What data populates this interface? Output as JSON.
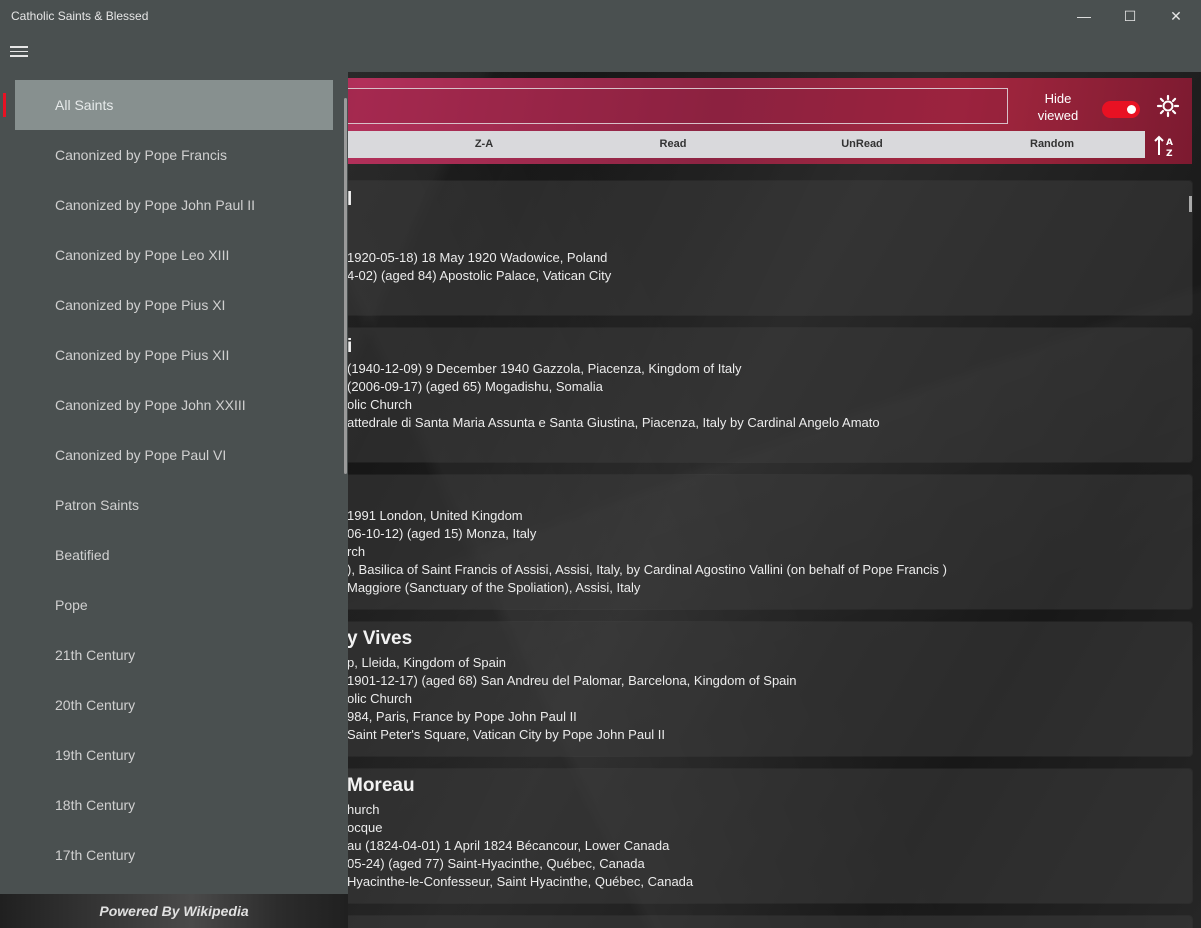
{
  "app": {
    "title": "Catholic Saints & Blessed",
    "window_controls": {
      "minimize": "—",
      "maximize": "☐",
      "close": "✕"
    }
  },
  "toolbar": {
    "hide_viewed_label": "Hide\nviewed",
    "hide_viewed_on": true,
    "accent_color": "#e81123",
    "sort_options": [
      "Z-A",
      "Read",
      "UnRead",
      "Random"
    ]
  },
  "drawer": {
    "items": [
      "All Saints",
      "Canonized by Pope Francis",
      "Canonized by Pope John Paul II",
      "Canonized by Pope Leo XIII",
      "Canonized by Pope Pius XI",
      "Canonized by Pope Pius XII",
      "Canonized by Pope John XXIII",
      "Canonized by Pope Paul VI",
      "Patron Saints",
      "Beatified",
      "Pope",
      "21th Century",
      "20th Century",
      "19th Century",
      "18th Century",
      "17th Century"
    ],
    "selected": "All Saints",
    "footer": "Powered By Wikipedia"
  },
  "cards": [
    {
      "title": "l",
      "lines": [
        "",
        "",
        "1920-05-18) 18 May 1920 Wadowice, Poland",
        "4-02) (aged 84) Apostolic Palace, Vatican City"
      ]
    },
    {
      "title": "i",
      "lines": [
        "(1940-12-09) 9 December 1940 Gazzola, Piacenza, Kingdom of Italy",
        "(2006-09-17) (aged 65) Mogadishu, Somalia",
        "olic Church",
        "attedrale di Santa Maria Assunta e Santa Giustina, Piacenza, Italy by Cardinal Angelo Amato"
      ]
    },
    {
      "title": "",
      "lines": [
        "1991 London, United Kingdom",
        "06-10-12) (aged 15) Monza, Italy",
        "rch",
        "), Basilica of Saint Francis of Assisi, Assisi, Italy, by Cardinal Agostino Vallini (on behalf of Pope Francis )",
        "Maggiore (Sanctuary of the Spoliation), Assisi, Italy"
      ]
    },
    {
      "title": "y Vives",
      "lines": [
        "p, Lleida, Kingdom of Spain",
        "1901-12-17) (aged 68) San Andreu del Palomar, Barcelona, Kingdom of Spain",
        "olic Church",
        "984, Paris, France by Pope John Paul II",
        "Saint Peter's Square, Vatican City by Pope John Paul II"
      ]
    },
    {
      "title": "Moreau",
      "lines": [
        "hurch",
        "ocque",
        "au (1824-04-01) 1 April 1824 Bécancour, Lower Canada",
        "05-24) (aged 77) Saint-Hyacinthe, Québec, Canada",
        "Hyacinthe-le-Confesseur, Saint Hyacinthe, Québec, Canada"
      ]
    }
  ]
}
